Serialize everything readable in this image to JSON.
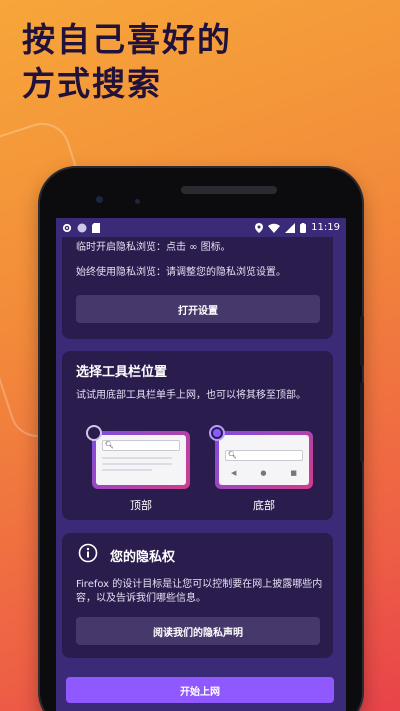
{
  "headline": {
    "line1": "按自己喜好的",
    "line2": "方式搜索"
  },
  "status_bar": {
    "time": "11:19"
  },
  "private_card": {
    "line1": "临时开启隐私浏览：点击 ∞ 图标。",
    "line2": "始终使用隐私浏览：请调整您的隐私浏览设置。",
    "button": "打开设置"
  },
  "toolbar_card": {
    "title": "选择工具栏位置",
    "description": "试试用底部工具栏单手上网，也可以将其移至顶部。",
    "options": [
      {
        "label": "顶部",
        "selected": false
      },
      {
        "label": "底部",
        "selected": true
      }
    ]
  },
  "privacy_card": {
    "title": "您的隐私权",
    "description": "Firefox 的设计目标是让您可以控制要在网上披露哪些内容，以及告诉我们哪些信息。",
    "button": "阅读我们的隐私声明"
  },
  "start_button": "开始上网",
  "colors": {
    "accent": "#9059ff",
    "card": "#2b1c4e",
    "screen": "#3a2a78"
  }
}
